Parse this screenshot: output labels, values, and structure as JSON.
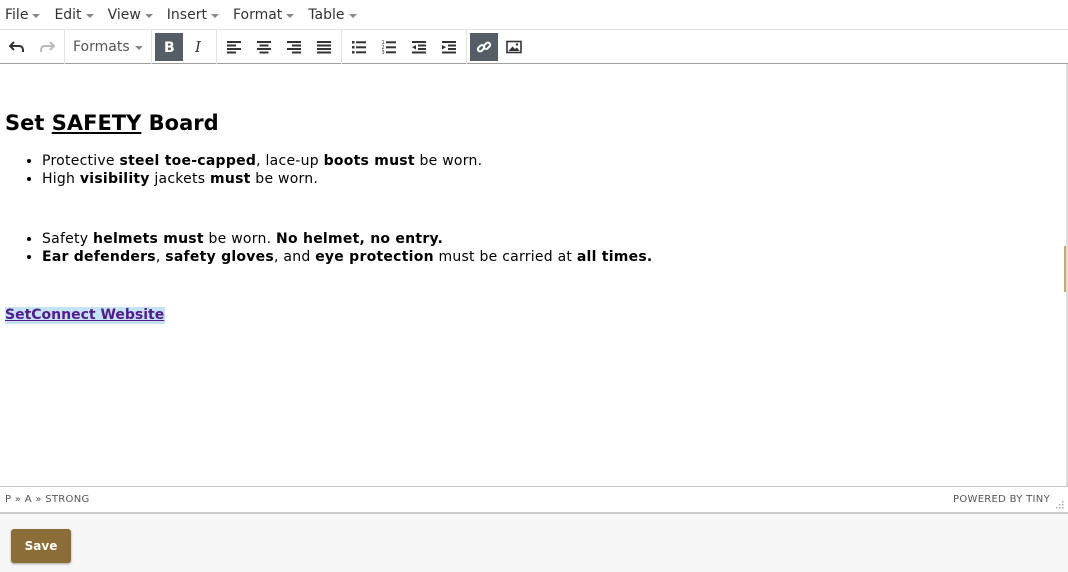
{
  "menubar": {
    "items": [
      {
        "label": "File"
      },
      {
        "label": "Edit"
      },
      {
        "label": "View"
      },
      {
        "label": "Insert"
      },
      {
        "label": "Format"
      },
      {
        "label": "Table"
      }
    ]
  },
  "toolbar": {
    "formats_label": "Formats",
    "active_color": "#555e66"
  },
  "content": {
    "heading": {
      "pre": "Set ",
      "underlined": "SAFETY",
      "post": " Board"
    },
    "list1": [
      {
        "t1": "Protective ",
        "b1": "steel toe-capped",
        "t2": ", lace-up ",
        "b2": "boots must",
        "t3": " be worn."
      },
      {
        "t1": "High ",
        "b1": "visibility",
        "t2": " jackets ",
        "b2": "must",
        "t3": " be worn."
      }
    ],
    "list2": [
      {
        "t1": "Safety ",
        "b1": "helmets must",
        "t2": " be worn. ",
        "b2": "No helmet, no entry.",
        "t3": ""
      },
      {
        "b1": "Ear defenders",
        "t1": ", ",
        "b2": "safety gloves",
        "t2": ", and ",
        "b3": "eye protection",
        "t3": " must be carried at ",
        "b4": "all times."
      }
    ],
    "link_text": "SetConnect Website",
    "link_color": "#551a8b"
  },
  "statusbar": {
    "path": "P » A » STRONG",
    "brand": "POWERED BY TINY"
  },
  "footer": {
    "save_label": "Save",
    "save_color": "#8a6d37"
  }
}
